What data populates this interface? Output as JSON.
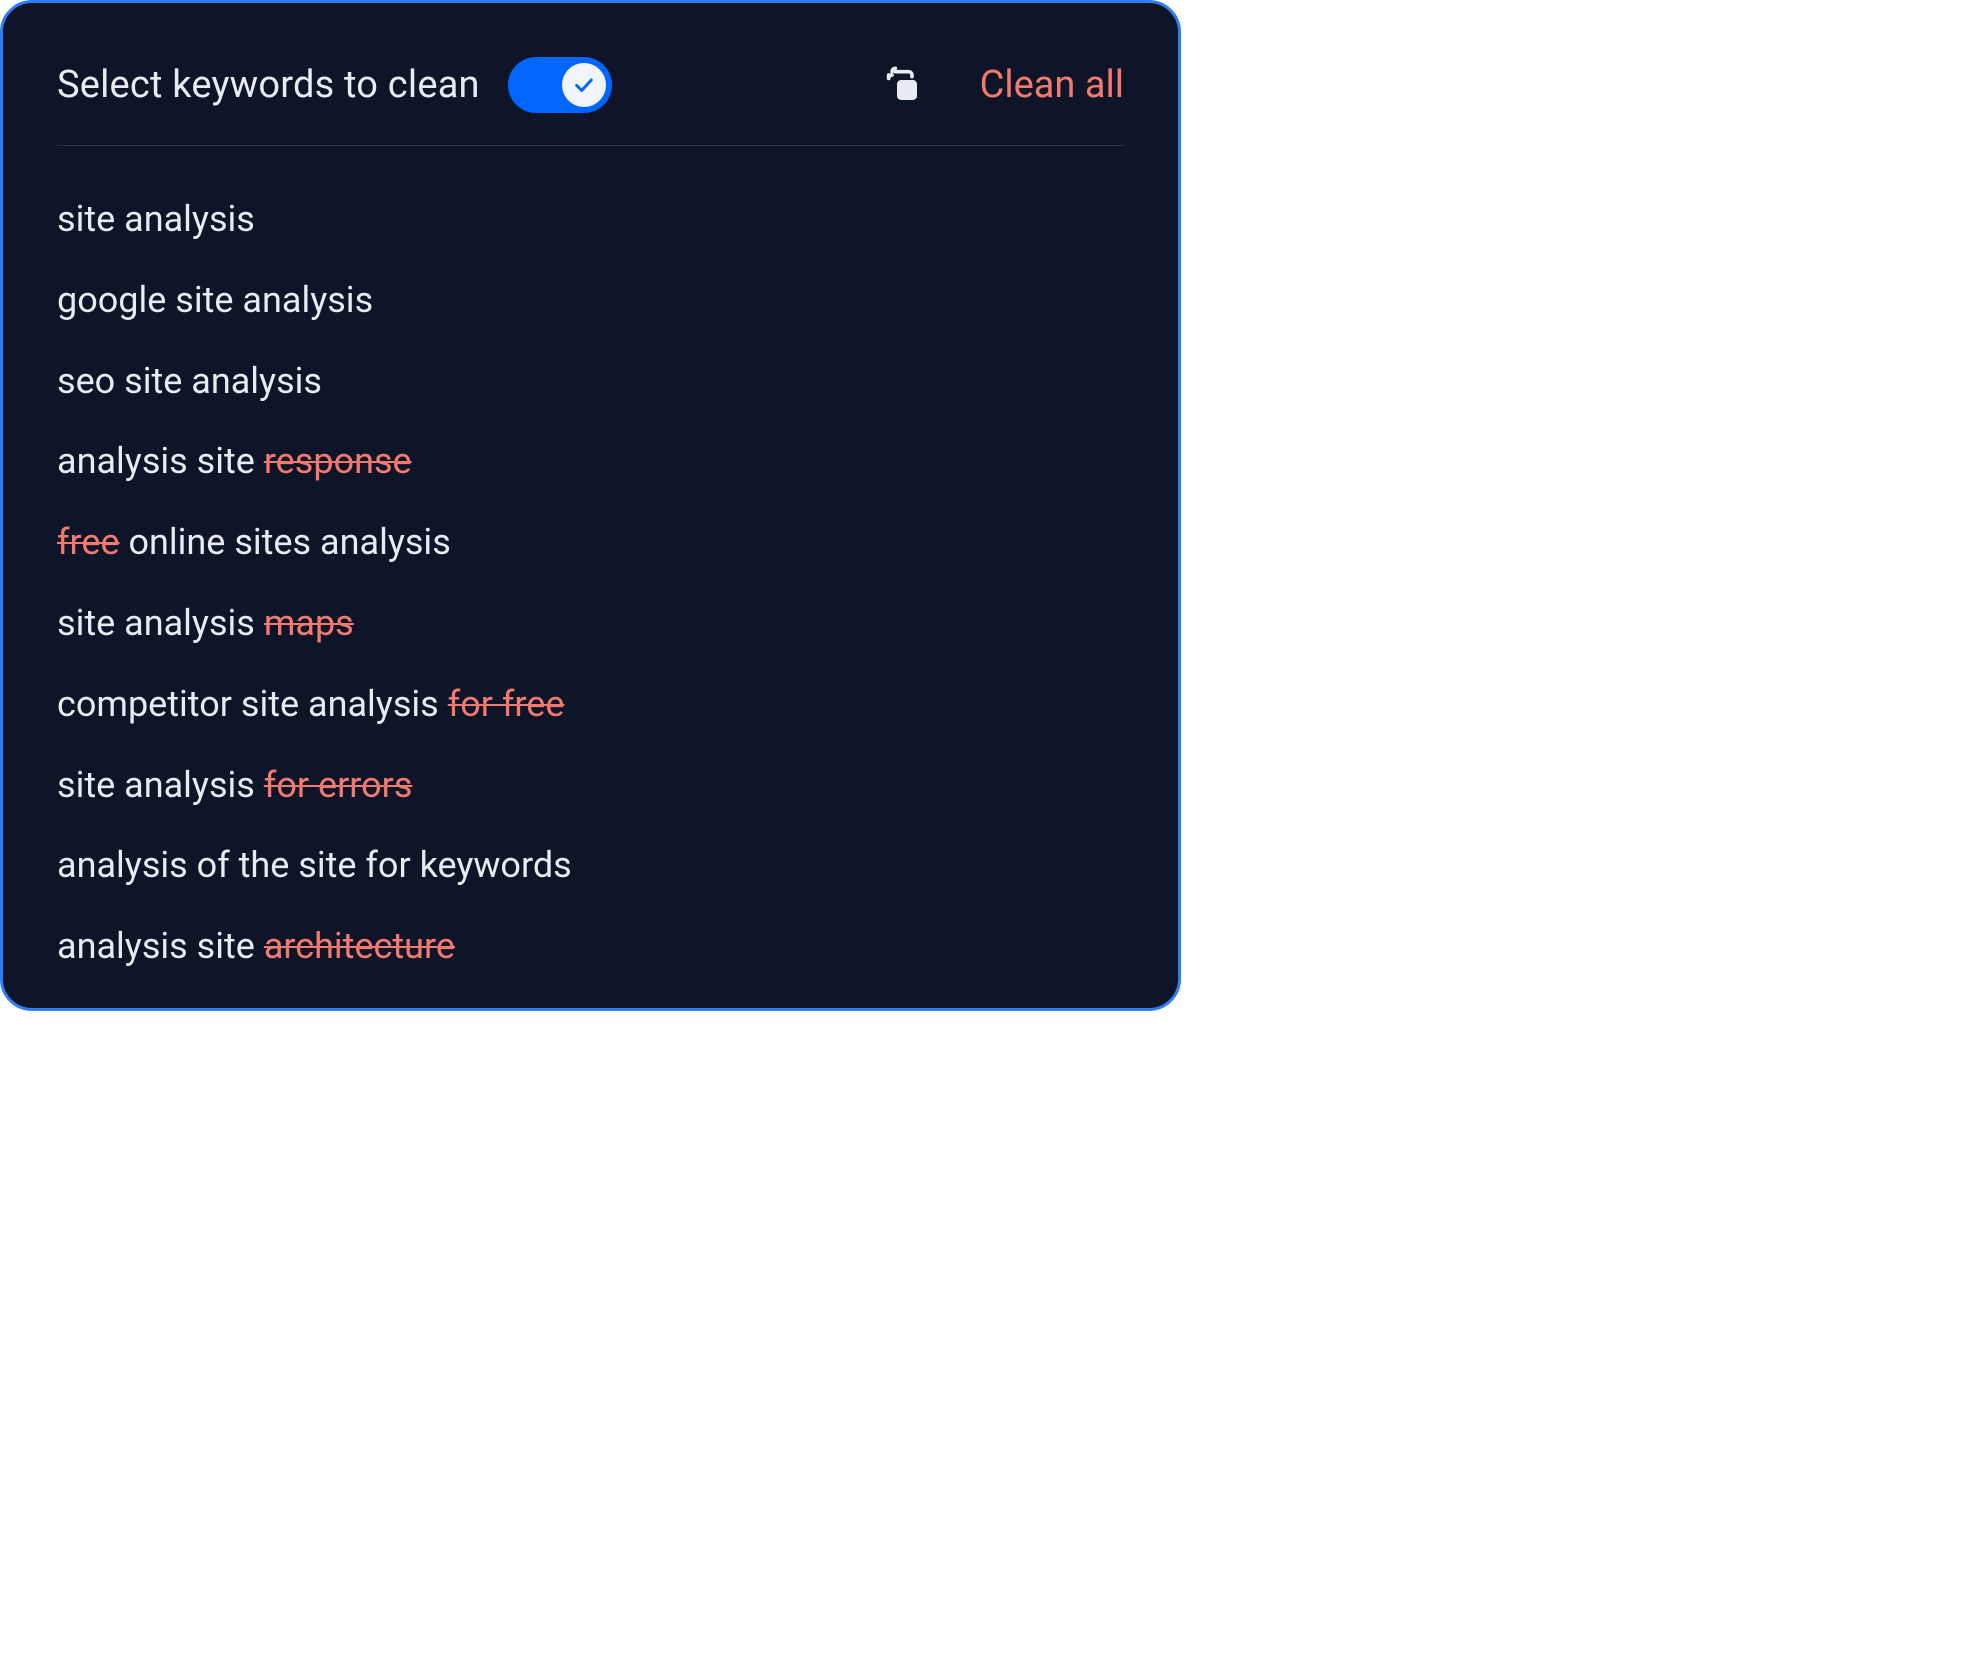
{
  "header": {
    "title": "Select keywords to clean",
    "toggle_on": true,
    "clean_all_label": "Clean all"
  },
  "keywords": [
    {
      "parts": [
        {
          "text": "site analysis",
          "struck": false
        }
      ]
    },
    {
      "parts": [
        {
          "text": "google site analysis",
          "struck": false
        }
      ]
    },
    {
      "parts": [
        {
          "text": "seo site analysis",
          "struck": false
        }
      ]
    },
    {
      "parts": [
        {
          "text": "analysis site ",
          "struck": false
        },
        {
          "text": "response",
          "struck": true
        }
      ]
    },
    {
      "parts": [
        {
          "text": "free",
          "struck": true
        },
        {
          "text": " online sites analysis",
          "struck": false
        }
      ]
    },
    {
      "parts": [
        {
          "text": "site analysis ",
          "struck": false
        },
        {
          "text": "maps",
          "struck": true
        }
      ]
    },
    {
      "parts": [
        {
          "text": "competitor site analysis ",
          "struck": false
        },
        {
          "text": "for free",
          "struck": true
        }
      ]
    },
    {
      "parts": [
        {
          "text": "site analysis ",
          "struck": false
        },
        {
          "text": "for errors",
          "struck": true
        }
      ]
    },
    {
      "parts": [
        {
          "text": "analysis of the site for keywords",
          "struck": false
        }
      ]
    },
    {
      "parts": [
        {
          "text": "analysis site ",
          "struck": false
        },
        {
          "text": "architecture",
          "struck": true
        }
      ]
    }
  ]
}
